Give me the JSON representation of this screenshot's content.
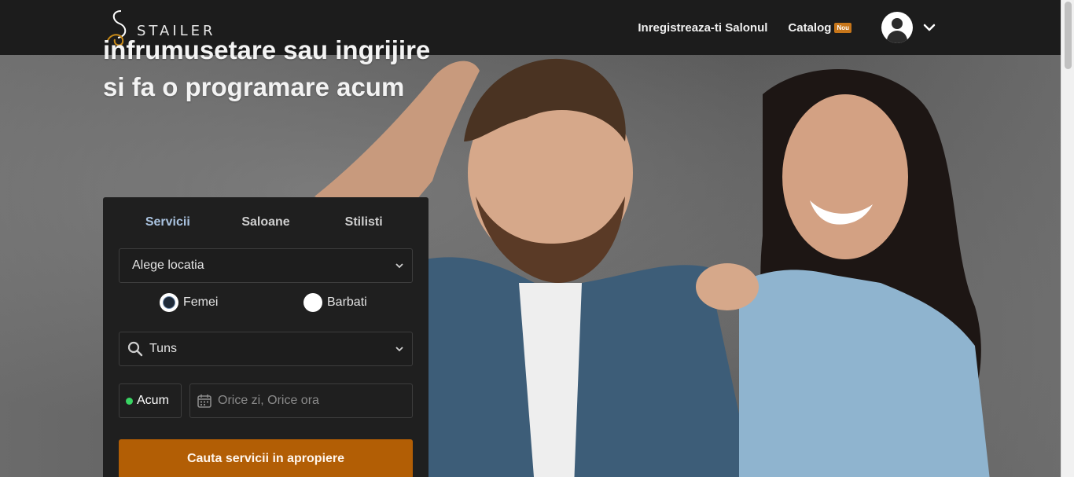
{
  "header": {
    "logo_text": "STAILER",
    "nav": {
      "register_salon": "Inregistreaza-ti Salonul",
      "catalog": "Catalog",
      "catalog_badge": "Nou"
    },
    "user_icon": "user-avatar-icon",
    "menu_icon": "chevron-down-icon"
  },
  "hero": {
    "headline": "infrumusetare sau ingrijire si fa o programare acum"
  },
  "search_card": {
    "tabs": [
      {
        "label": "Servicii",
        "active": true
      },
      {
        "label": "Saloane",
        "active": false
      },
      {
        "label": "Stilisti",
        "active": false
      }
    ],
    "location_select": {
      "value": "Alege locatia"
    },
    "gender": {
      "women_label": "Femei",
      "men_label": "Barbati",
      "selected": "Femei"
    },
    "service_select": {
      "value": "Tuns"
    },
    "now_button": "Acum",
    "date_input": {
      "placeholder": "Orice zi, Orice ora"
    },
    "cta_label": "Cauta servicii in apropiere"
  },
  "colors": {
    "header_bg": "#1c1c1c",
    "card_bg": "#1f1f1f",
    "cta_bg": "#b25e05",
    "active_tab": "#aac3e0",
    "badge": "#c7761a",
    "now_dot": "#39d463"
  }
}
